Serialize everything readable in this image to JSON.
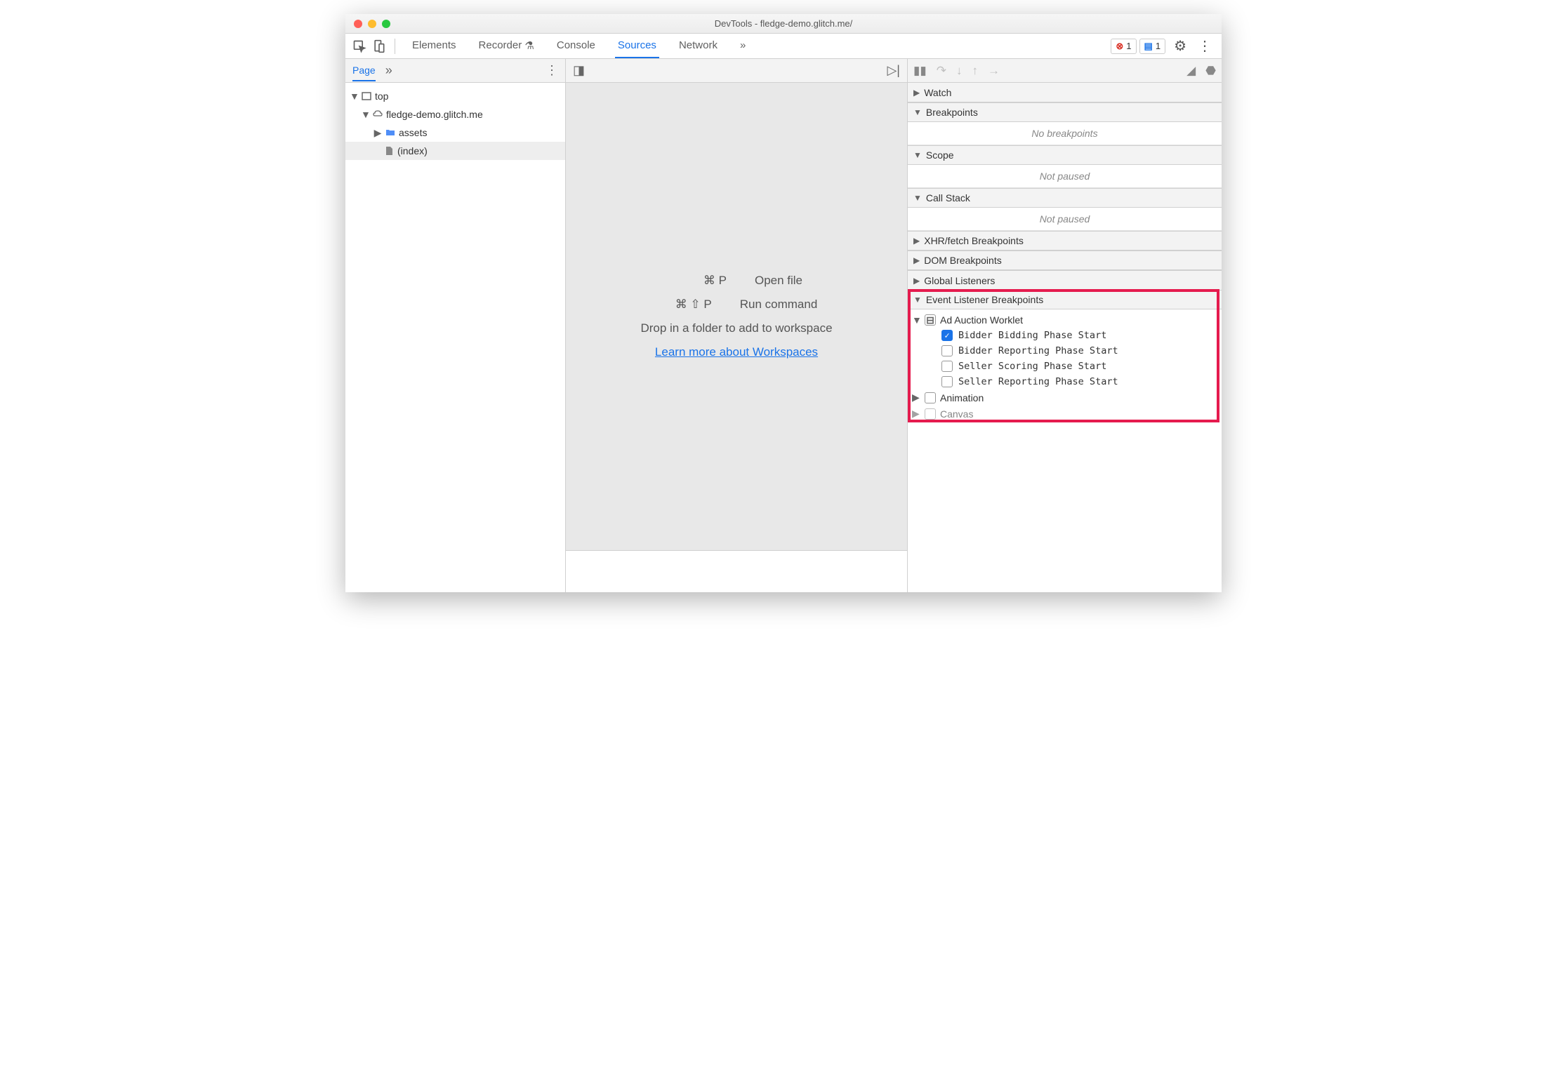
{
  "window": {
    "title": "DevTools - fledge-demo.glitch.me/"
  },
  "toolbar": {
    "tabs": {
      "elements": "Elements",
      "recorder": "Recorder",
      "console": "Console",
      "sources": "Sources",
      "network": "Network"
    },
    "error_count": "1",
    "message_count": "1"
  },
  "nav": {
    "page_tab": "Page",
    "tree": {
      "top": "top",
      "origin": "fledge-demo.glitch.me",
      "assets": "assets",
      "index": "(index)"
    }
  },
  "editor": {
    "open_file_keys": "⌘ P",
    "open_file": "Open file",
    "run_command_keys": "⌘ ⇧ P",
    "run_command": "Run command",
    "drop": "Drop in a folder to add to workspace",
    "learn_more": "Learn more about Workspaces"
  },
  "debugger": {
    "sections": {
      "watch": "Watch",
      "breakpoints": "Breakpoints",
      "breakpoints_empty": "No breakpoints",
      "scope": "Scope",
      "scope_empty": "Not paused",
      "call_stack": "Call Stack",
      "call_stack_empty": "Not paused",
      "xhr": "XHR/fetch Breakpoints",
      "dom": "DOM Breakpoints",
      "global": "Global Listeners",
      "elb": "Event Listener Breakpoints",
      "ad_auction": "Ad Auction Worklet",
      "bidder_bidding": "Bidder Bidding Phase Start",
      "bidder_reporting": "Bidder Reporting Phase Start",
      "seller_scoring": "Seller Scoring Phase Start",
      "seller_reporting": "Seller Reporting Phase Start",
      "animation": "Animation",
      "canvas": "Canvas"
    }
  }
}
